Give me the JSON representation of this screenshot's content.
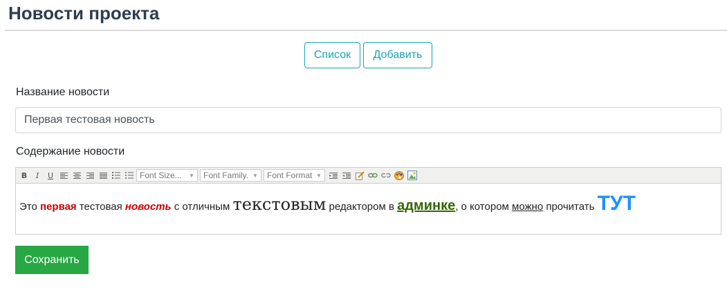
{
  "header": {
    "title": "Новости проекта"
  },
  "top_buttons": {
    "list_label": "Список",
    "add_label": "Добавить"
  },
  "form": {
    "title_label": "Название новости",
    "title_value": "Первая тестовая новость",
    "content_label": "Содержание новости",
    "toolbar": {
      "font_size": "Font Size...",
      "font_family": "Font Family.",
      "font_format": "Font Format"
    },
    "content": {
      "w1": "Это ",
      "w2": "первая",
      "w3": " тестовая ",
      "w4": "новость",
      "w5": " с отличным ",
      "w6": "текстовым",
      "w7": " редактором в ",
      "w8": "админке",
      "w9": ", о котором ",
      "w10": "можно",
      "w11": " прочитать ",
      "w12": "ТУТ"
    },
    "save_label": "Сохранить"
  },
  "colors": {
    "accent": "#17a2b8",
    "success": "#28a745",
    "title": "#2c3e50",
    "red_text": "#cc0000",
    "green_text": "#336600",
    "blue_text": "#1e90ff"
  }
}
